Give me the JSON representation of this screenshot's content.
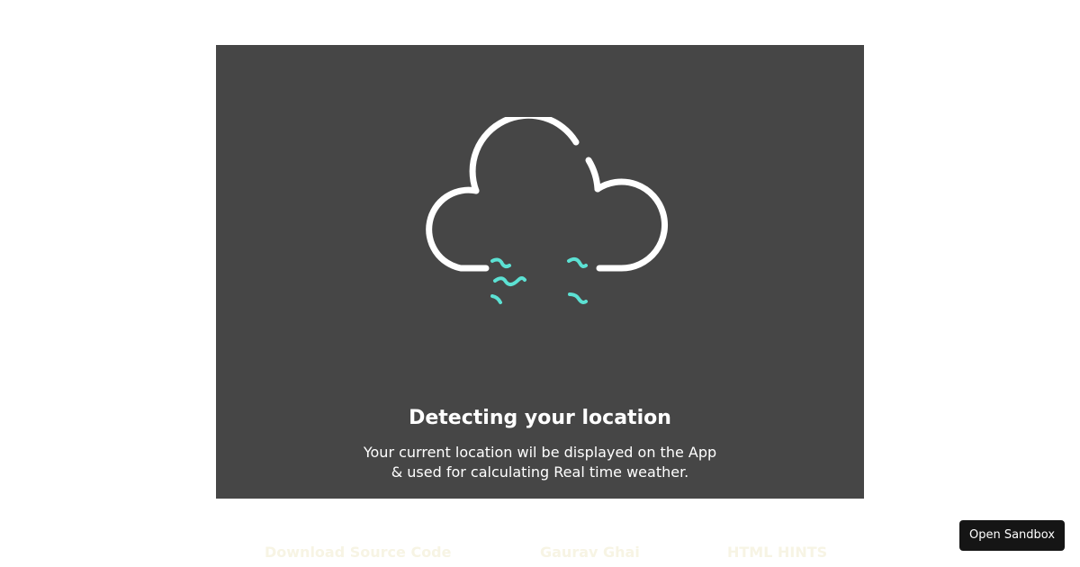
{
  "card": {
    "title": "Detecting your location",
    "description_line1": "Your current location wil be displayed on the App",
    "description_line2": "& used for calculating Real time weather.",
    "icon": "cloud-wind-icon",
    "background_color": "#464646",
    "accent_color": "#5ce1d3"
  },
  "footer": {
    "links": [
      {
        "label": "Download Source Code"
      },
      {
        "label": "Gaurav Ghai"
      },
      {
        "label": "HTML HINTS"
      }
    ]
  },
  "sandbox_button": {
    "label": "Open Sandbox"
  }
}
